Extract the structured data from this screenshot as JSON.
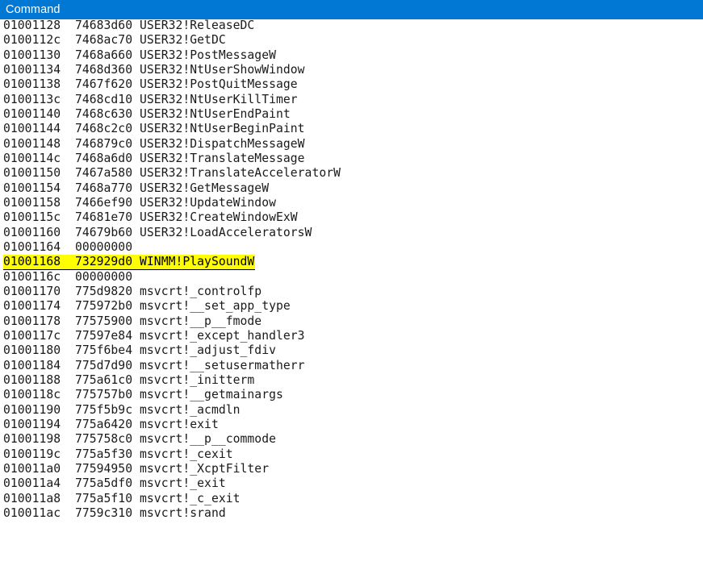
{
  "window": {
    "title": "Command",
    "titlebar_color": "#0078d4",
    "titlebar_text_color": "#ffffff",
    "background_color": "#ffffff",
    "text_color": "#1a1a1a",
    "highlight_color": "#ffff00"
  },
  "listing": {
    "columns": [
      "address",
      "value",
      "symbol"
    ],
    "rows": [
      {
        "address": "01001128",
        "value": "74683d60",
        "symbol": "USER32!ReleaseDC",
        "highlight": false
      },
      {
        "address": "0100112c",
        "value": "7468ac70",
        "symbol": "USER32!GetDC",
        "highlight": false
      },
      {
        "address": "01001130",
        "value": "7468a660",
        "symbol": "USER32!PostMessageW",
        "highlight": false
      },
      {
        "address": "01001134",
        "value": "7468d360",
        "symbol": "USER32!NtUserShowWindow",
        "highlight": false
      },
      {
        "address": "01001138",
        "value": "7467f620",
        "symbol": "USER32!PostQuitMessage",
        "highlight": false
      },
      {
        "address": "0100113c",
        "value": "7468cd10",
        "symbol": "USER32!NtUserKillTimer",
        "highlight": false
      },
      {
        "address": "01001140",
        "value": "7468c630",
        "symbol": "USER32!NtUserEndPaint",
        "highlight": false
      },
      {
        "address": "01001144",
        "value": "7468c2c0",
        "symbol": "USER32!NtUserBeginPaint",
        "highlight": false
      },
      {
        "address": "01001148",
        "value": "746879c0",
        "symbol": "USER32!DispatchMessageW",
        "highlight": false
      },
      {
        "address": "0100114c",
        "value": "7468a6d0",
        "symbol": "USER32!TranslateMessage",
        "highlight": false
      },
      {
        "address": "01001150",
        "value": "7467a580",
        "symbol": "USER32!TranslateAcceleratorW",
        "highlight": false
      },
      {
        "address": "01001154",
        "value": "7468a770",
        "symbol": "USER32!GetMessageW",
        "highlight": false
      },
      {
        "address": "01001158",
        "value": "7466ef90",
        "symbol": "USER32!UpdateWindow",
        "highlight": false
      },
      {
        "address": "0100115c",
        "value": "74681e70",
        "symbol": "USER32!CreateWindowExW",
        "highlight": false
      },
      {
        "address": "01001160",
        "value": "74679b60",
        "symbol": "USER32!LoadAcceleratorsW",
        "highlight": false
      },
      {
        "address": "01001164",
        "value": "00000000",
        "symbol": "",
        "highlight": false
      },
      {
        "address": "01001168",
        "value": "732929d0",
        "symbol": "WINMM!PlaySoundW",
        "highlight": true
      },
      {
        "address": "0100116c",
        "value": "00000000",
        "symbol": "",
        "highlight": false
      },
      {
        "address": "01001170",
        "value": "775d9820",
        "symbol": "msvcrt!_controlfp",
        "highlight": false
      },
      {
        "address": "01001174",
        "value": "775972b0",
        "symbol": "msvcrt!__set_app_type",
        "highlight": false
      },
      {
        "address": "01001178",
        "value": "77575900",
        "symbol": "msvcrt!__p__fmode",
        "highlight": false
      },
      {
        "address": "0100117c",
        "value": "77597e84",
        "symbol": "msvcrt!_except_handler3",
        "highlight": false
      },
      {
        "address": "01001180",
        "value": "775f6be4",
        "symbol": "msvcrt!_adjust_fdiv",
        "highlight": false
      },
      {
        "address": "01001184",
        "value": "775d7d90",
        "symbol": "msvcrt!__setusermatherr",
        "highlight": false
      },
      {
        "address": "01001188",
        "value": "775a61c0",
        "symbol": "msvcrt!_initterm",
        "highlight": false
      },
      {
        "address": "0100118c",
        "value": "775757b0",
        "symbol": "msvcrt!__getmainargs",
        "highlight": false
      },
      {
        "address": "01001190",
        "value": "775f5b9c",
        "symbol": "msvcrt!_acmdln",
        "highlight": false
      },
      {
        "address": "01001194",
        "value": "775a6420",
        "symbol": "msvcrt!exit",
        "highlight": false
      },
      {
        "address": "01001198",
        "value": "775758c0",
        "symbol": "msvcrt!__p__commode",
        "highlight": false
      },
      {
        "address": "0100119c",
        "value": "775a5f30",
        "symbol": "msvcrt!_cexit",
        "highlight": false
      },
      {
        "address": "010011a0",
        "value": "77594950",
        "symbol": "msvcrt!_XcptFilter",
        "highlight": false
      },
      {
        "address": "010011a4",
        "value": "775a5df0",
        "symbol": "msvcrt!_exit",
        "highlight": false
      },
      {
        "address": "010011a8",
        "value": "775a5f10",
        "symbol": "msvcrt!_c_exit",
        "highlight": false
      },
      {
        "address": "010011ac",
        "value": "7759c310",
        "symbol": "msvcrt!srand",
        "highlight": false
      }
    ]
  }
}
